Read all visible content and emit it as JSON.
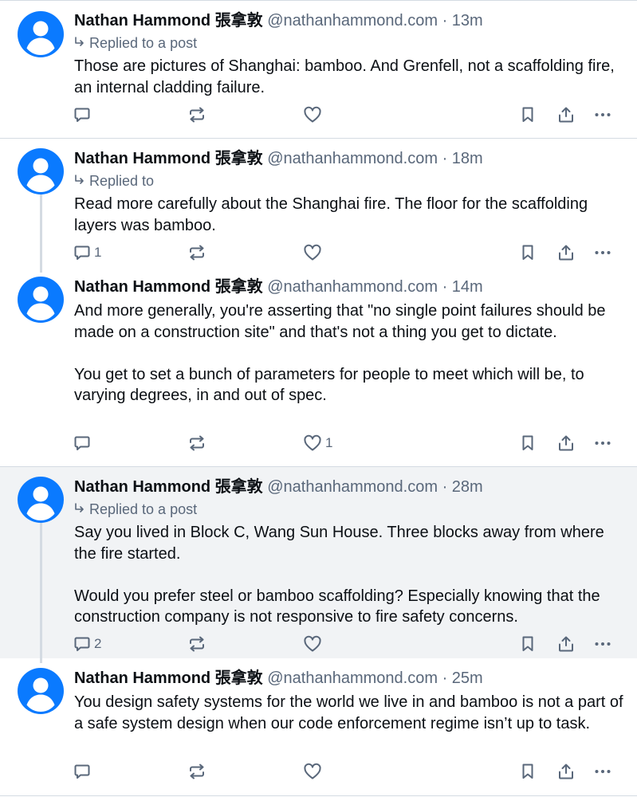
{
  "colors": {
    "avatar": "#0a7aff",
    "muted": "#59677a",
    "text": "#0b0f14",
    "highlight_bg": "#f1f3f5"
  },
  "icons": {
    "reply": "speech-bubble-icon",
    "repost": "repost-arrows-icon",
    "like": "heart-icon",
    "bookmark": "bookmark-icon",
    "share": "share-icon",
    "more": "ellipsis-icon"
  },
  "posts": [
    {
      "author": "Nathan Hammond 張拿敦",
      "handle": "@nathanhammond.com",
      "separator": "·",
      "time": "13m",
      "reply_context": "Replied to a post",
      "text": "Those are pictures of Shanghai: bamboo. And Grenfell, not a scaffolding fire, an internal cladding failure.",
      "reply_count": "",
      "like_count": ""
    },
    {
      "author": "Nathan Hammond 張拿敦",
      "handle": "@nathanhammond.com",
      "separator": "·",
      "time": "18m",
      "reply_context": "Replied to",
      "text": "Read more carefully about the Shanghai fire. The floor for the scaffolding layers was bamboo.",
      "reply_count": "1",
      "like_count": ""
    },
    {
      "author": "Nathan Hammond 張拿敦",
      "handle": "@nathanhammond.com",
      "separator": "·",
      "time": "14m",
      "text": "And more generally, you're asserting that \"no single point failures should be made on a construction site\" and that's not a thing you get to dictate.\n\nYou get to set a bunch of parameters for people to meet which will be, to varying degrees, in and out of spec.",
      "reply_count": "",
      "like_count": "1"
    },
    {
      "author": "Nathan Hammond 張拿敦",
      "handle": "@nathanhammond.com",
      "separator": "·",
      "time": "28m",
      "reply_context": "Replied to a post",
      "text": "Say you lived in Block C, Wang Sun House. Three blocks away from where the fire started.\n\nWould you prefer steel or bamboo scaffolding? Especially knowing that the construction company is not responsive to fire safety concerns.",
      "reply_count": "2",
      "like_count": ""
    },
    {
      "author": "Nathan Hammond 張拿敦",
      "handle": "@nathanhammond.com",
      "separator": "·",
      "time": "25m",
      "text": "You design safety systems for the world we live in and bamboo is not a part of a safe system design when our code enforcement regime isn’t up to task.",
      "reply_count": "",
      "like_count": ""
    }
  ]
}
